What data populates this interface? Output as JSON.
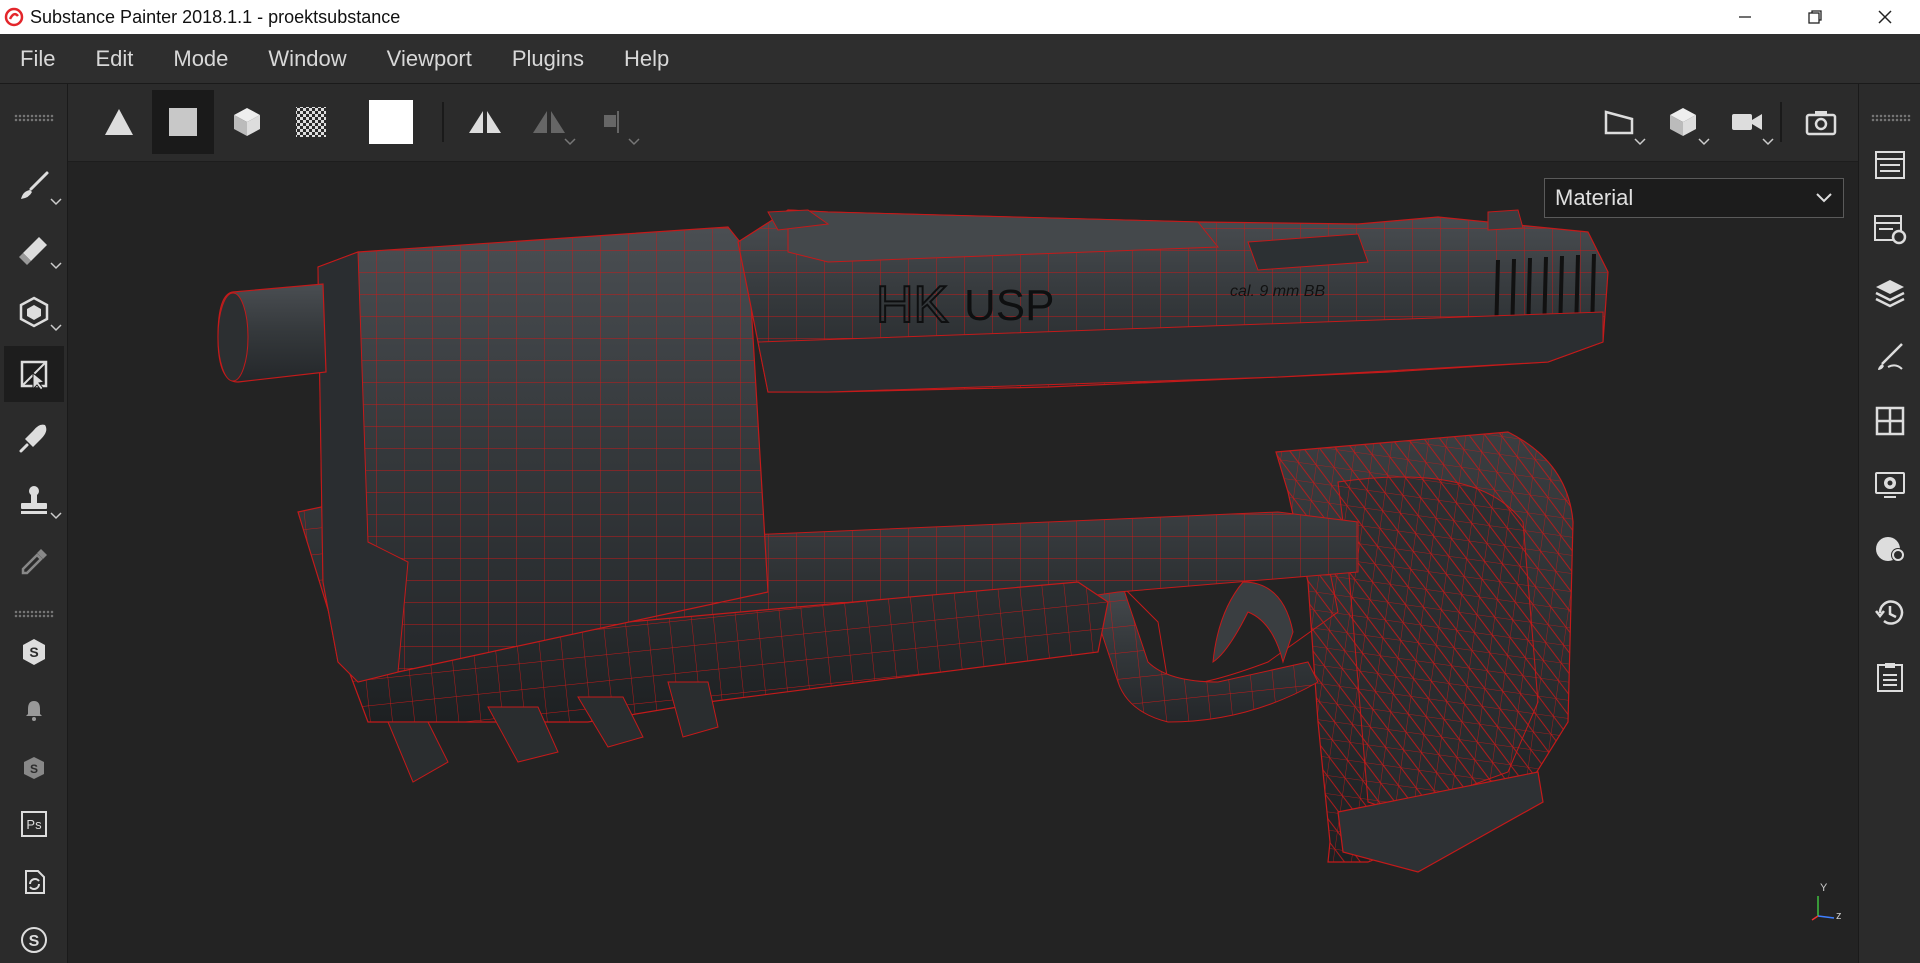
{
  "window": {
    "title": "Substance Painter 2018.1.1 - proektsubstance",
    "controls": [
      "minimize-icon",
      "restore-icon",
      "close-icon"
    ]
  },
  "menu": {
    "items": [
      "File",
      "Edit",
      "Mode",
      "Window",
      "Viewport",
      "Plugins",
      "Help"
    ]
  },
  "left_toolbar": {
    "tools": [
      "paint-brush-icon",
      "eraser-icon",
      "projection-icon",
      "polygon-fill-icon",
      "smudge-icon",
      "clone-stamp-icon",
      "color-picker-icon"
    ],
    "plugins": [
      "substance-share-icon",
      "notification-bell-icon",
      "substance-source-icon",
      "photoshop-export-icon",
      "sync-icon",
      "substance-logo-icon"
    ],
    "active_tool": "polygon-fill-icon"
  },
  "top_toolbar": {
    "fill_modes": [
      "triangle-fill-icon",
      "polygon-fill-square-icon",
      "mesh-fill-icon",
      "uv-chunk-fill-icon"
    ],
    "active_mode": "polygon-fill-square-icon",
    "swatch_color": "#ffffff",
    "symmetry": [
      "mirror-icon",
      "mirror-options-icon",
      "symmetry-axis-icon"
    ],
    "view": [
      "2d-view-icon",
      "3d-view-icon",
      "camera-icon",
      "screenshot-icon"
    ]
  },
  "viewport": {
    "display_mode": "Material",
    "model_engraving": {
      "brand": "HK",
      "model": "USP",
      "caliber": "cal. 9 mm BB"
    },
    "wire_color": "#c41a1a",
    "gizmo": {
      "y": "Y",
      "z": "z"
    }
  },
  "right_toolbar": {
    "panels": [
      "layers-list-icon",
      "texture-set-settings-icon",
      "layers-stack-icon",
      "properties-icon",
      "display-settings-icon",
      "viewer-settings-icon",
      "shelf-icon",
      "history-icon",
      "log-icon"
    ]
  },
  "colors": {
    "bg": "#252525",
    "panel": "#2b2b2b",
    "accent_red": "#e3262b"
  }
}
